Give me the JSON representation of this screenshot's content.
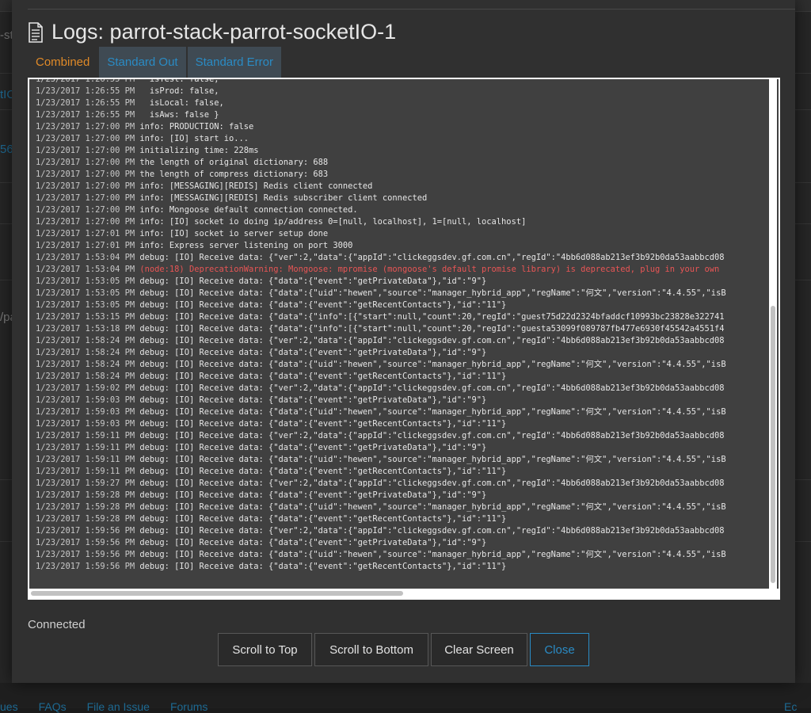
{
  "modal": {
    "title": "Logs: parrot-stack-parrot-socketIO-1",
    "tabs": [
      {
        "label": "Combined",
        "active": true
      },
      {
        "label": "Standard Out",
        "active": false
      },
      {
        "label": "Standard Error",
        "active": false
      }
    ],
    "status": "Connected",
    "buttons": {
      "scroll_top": "Scroll to Top",
      "scroll_bottom": "Scroll to Bottom",
      "clear": "Clear Screen",
      "close": "Close"
    }
  },
  "log": [
    {
      "ts": "1/23/2017 1:26:55 PM",
      "msg": "  isTest: false,"
    },
    {
      "ts": "1/23/2017 1:26:55 PM",
      "msg": "  isProd: false,"
    },
    {
      "ts": "1/23/2017 1:26:55 PM",
      "msg": "  isLocal: false,"
    },
    {
      "ts": "1/23/2017 1:26:55 PM",
      "msg": "  isAws: false }"
    },
    {
      "ts": "1/23/2017 1:27:00 PM",
      "msg": "info: PRODUCTION: false"
    },
    {
      "ts": "1/23/2017 1:27:00 PM",
      "msg": "info: [IO] start io..."
    },
    {
      "ts": "1/23/2017 1:27:00 PM",
      "msg": "initializing time: 228ms"
    },
    {
      "ts": "1/23/2017 1:27:00 PM",
      "msg": "the length of original dictionary: 688"
    },
    {
      "ts": "1/23/2017 1:27:00 PM",
      "msg": "the length of compress dictionary: 683"
    },
    {
      "ts": "1/23/2017 1:27:00 PM",
      "msg": "info: [MESSAGING][REDIS] Redis client connected"
    },
    {
      "ts": "1/23/2017 1:27:00 PM",
      "msg": "info: [MESSAGING][REDIS] Redis subscriber client connected"
    },
    {
      "ts": "1/23/2017 1:27:00 PM",
      "msg": "info: Mongoose default connection connected."
    },
    {
      "ts": "1/23/2017 1:27:00 PM",
      "msg": "info: [IO] socket io doing ip/address 0=[null, localhost], 1=[null, localhost]"
    },
    {
      "ts": "1/23/2017 1:27:01 PM",
      "msg": "info: [IO] socket io server setup done"
    },
    {
      "ts": "1/23/2017 1:27:01 PM",
      "msg": "info: Express server listening on port 3000"
    },
    {
      "ts": "1/23/2017 1:53:04 PM",
      "msg": "debug: [IO] Receive data: {\"ver\":2,\"data\":{\"appId\":\"clickeggsdev.gf.com.cn\",\"regId\":\"4bb6d088ab213ef3b92b0da53aabbcd08"
    },
    {
      "ts": "1/23/2017 1:53:04 PM",
      "msg": "(node:18) DeprecationWarning: Mongoose: mpromise (mongoose's default promise library) is deprecated, plug in your own",
      "error": true
    },
    {
      "ts": "1/23/2017 1:53:05 PM",
      "msg": "debug: [IO] Receive data: {\"data\":{\"event\":\"getPrivateData\"},\"id\":\"9\"}"
    },
    {
      "ts": "1/23/2017 1:53:05 PM",
      "msg": "debug: [IO] Receive data: {\"data\":{\"uid\":\"hewen\",\"source\":\"manager_hybrid_app\",\"regName\":\"何文\",\"version\":\"4.4.55\",\"isB"
    },
    {
      "ts": "1/23/2017 1:53:05 PM",
      "msg": "debug: [IO] Receive data: {\"data\":{\"event\":\"getRecentContacts\"},\"id\":\"11\"}"
    },
    {
      "ts": "1/23/2017 1:53:15 PM",
      "msg": "debug: [IO] Receive data: {\"data\":{\"info\":[{\"start\":null,\"count\":20,\"regId\":\"guest75d22d2324bfaddcf10993bc23828e322741"
    },
    {
      "ts": "1/23/2017 1:53:18 PM",
      "msg": "debug: [IO] Receive data: {\"data\":{\"info\":[{\"start\":null,\"count\":20,\"regId\":\"guesta53099f089787fb477e6930f45542a4551f4"
    },
    {
      "ts": "1/23/2017 1:58:24 PM",
      "msg": "debug: [IO] Receive data: {\"ver\":2,\"data\":{\"appId\":\"clickeggsdev.gf.com.cn\",\"regId\":\"4bb6d088ab213ef3b92b0da53aabbcd08"
    },
    {
      "ts": "1/23/2017 1:58:24 PM",
      "msg": "debug: [IO] Receive data: {\"data\":{\"event\":\"getPrivateData\"},\"id\":\"9\"}"
    },
    {
      "ts": "1/23/2017 1:58:24 PM",
      "msg": "debug: [IO] Receive data: {\"data\":{\"uid\":\"hewen\",\"source\":\"manager_hybrid_app\",\"regName\":\"何文\",\"version\":\"4.4.55\",\"isB"
    },
    {
      "ts": "1/23/2017 1:58:24 PM",
      "msg": "debug: [IO] Receive data: {\"data\":{\"event\":\"getRecentContacts\"},\"id\":\"11\"}"
    },
    {
      "ts": "1/23/2017 1:59:02 PM",
      "msg": "debug: [IO] Receive data: {\"ver\":2,\"data\":{\"appId\":\"clickeggsdev.gf.com.cn\",\"regId\":\"4bb6d088ab213ef3b92b0da53aabbcd08"
    },
    {
      "ts": "1/23/2017 1:59:03 PM",
      "msg": "debug: [IO] Receive data: {\"data\":{\"event\":\"getPrivateData\"},\"id\":\"9\"}"
    },
    {
      "ts": "1/23/2017 1:59:03 PM",
      "msg": "debug: [IO] Receive data: {\"data\":{\"uid\":\"hewen\",\"source\":\"manager_hybrid_app\",\"regName\":\"何文\",\"version\":\"4.4.55\",\"isB"
    },
    {
      "ts": "1/23/2017 1:59:03 PM",
      "msg": "debug: [IO] Receive data: {\"data\":{\"event\":\"getRecentContacts\"},\"id\":\"11\"}"
    },
    {
      "ts": "1/23/2017 1:59:11 PM",
      "msg": "debug: [IO] Receive data: {\"ver\":2,\"data\":{\"appId\":\"clickeggsdev.gf.com.cn\",\"regId\":\"4bb6d088ab213ef3b92b0da53aabbcd08"
    },
    {
      "ts": "1/23/2017 1:59:11 PM",
      "msg": "debug: [IO] Receive data: {\"data\":{\"event\":\"getPrivateData\"},\"id\":\"9\"}"
    },
    {
      "ts": "1/23/2017 1:59:11 PM",
      "msg": "debug: [IO] Receive data: {\"data\":{\"uid\":\"hewen\",\"source\":\"manager_hybrid_app\",\"regName\":\"何文\",\"version\":\"4.4.55\",\"isB"
    },
    {
      "ts": "1/23/2017 1:59:11 PM",
      "msg": "debug: [IO] Receive data: {\"data\":{\"event\":\"getRecentContacts\"},\"id\":\"11\"}"
    },
    {
      "ts": "1/23/2017 1:59:27 PM",
      "msg": "debug: [IO] Receive data: {\"ver\":2,\"data\":{\"appId\":\"clickeggsdev.gf.com.cn\",\"regId\":\"4bb6d088ab213ef3b92b0da53aabbcd08"
    },
    {
      "ts": "1/23/2017 1:59:28 PM",
      "msg": "debug: [IO] Receive data: {\"data\":{\"event\":\"getPrivateData\"},\"id\":\"9\"}"
    },
    {
      "ts": "1/23/2017 1:59:28 PM",
      "msg": "debug: [IO] Receive data: {\"data\":{\"uid\":\"hewen\",\"source\":\"manager_hybrid_app\",\"regName\":\"何文\",\"version\":\"4.4.55\",\"isB"
    },
    {
      "ts": "1/23/2017 1:59:28 PM",
      "msg": "debug: [IO] Receive data: {\"data\":{\"event\":\"getRecentContacts\"},\"id\":\"11\"}"
    },
    {
      "ts": "1/23/2017 1:59:56 PM",
      "msg": "debug: [IO] Receive data: {\"ver\":2,\"data\":{\"appId\":\"clickeggsdev.gf.com.cn\",\"regId\":\"4bb6d088ab213ef3b92b0da53aabbcd08"
    },
    {
      "ts": "1/23/2017 1:59:56 PM",
      "msg": "debug: [IO] Receive data: {\"data\":{\"event\":\"getPrivateData\"},\"id\":\"9\"}"
    },
    {
      "ts": "1/23/2017 1:59:56 PM",
      "msg": "debug: [IO] Receive data: {\"data\":{\"uid\":\"hewen\",\"source\":\"manager_hybrid_app\",\"regName\":\"何文\",\"version\":\"4.4.55\",\"isB"
    },
    {
      "ts": "1/23/2017 1:59:56 PM",
      "msg": "debug: [IO] Receive data: {\"data\":{\"event\":\"getRecentContacts\"},\"id\":\"11\"}"
    }
  ],
  "background": {
    "fragments": [
      "-st",
      "tIO",
      "56d",
      "/pa"
    ],
    "footer_links": [
      "ues",
      "FAQs",
      "File an Issue",
      "Forums"
    ],
    "footer_right": "Ec"
  },
  "colors": {
    "accent": "#2a8bc4",
    "active_tab": "#e08a28",
    "error_text": "#e85555"
  }
}
